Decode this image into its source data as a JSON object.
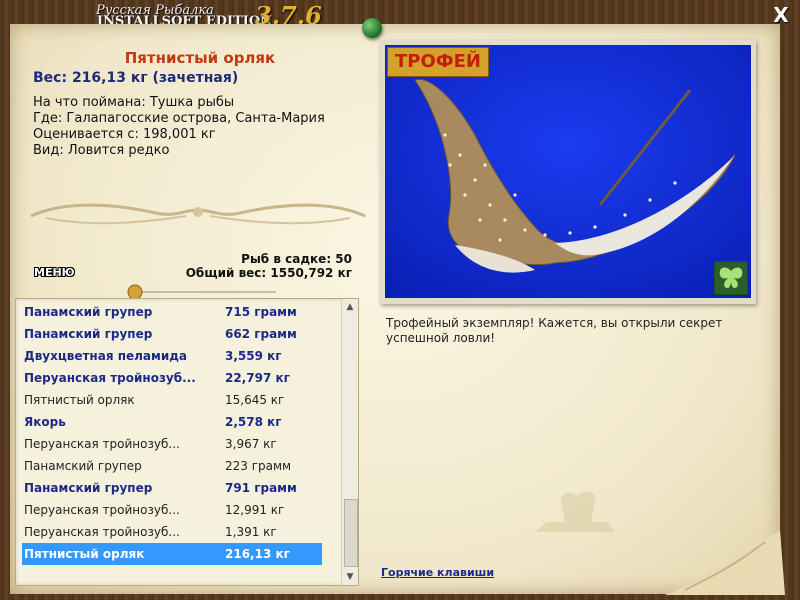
{
  "window": {
    "title_line1": "Русская Рыбалка",
    "title_line2": "INSTALLSOFT EDITION",
    "version": "3.7.6",
    "close_label": "X"
  },
  "catch": {
    "name": "Пятнистый орляк",
    "weight": "Вес: 216,13 кг (зачетная)",
    "bait": "На что поймана: Тушка рыбы",
    "place": "Где: Галапагосские острова, Санта-Мария",
    "value": "Оценивается с: 198,001 кг",
    "kind": "Вид: Ловится редко"
  },
  "stats": {
    "fish_count": "Рыб в садке: 50",
    "total_weight": "Общий вес: 1550,792 кг"
  },
  "menu_label": "МЕНЮ",
  "trophy": {
    "badge": "ТРОФЕЙ",
    "text": "Трофейный экземпляр! Кажется, вы открыли секрет успешной ловли!"
  },
  "hotkeys_label": "Горячие клавиши",
  "catches": [
    {
      "name": "Панамский групер",
      "weight": "715 грамм",
      "style": "bold"
    },
    {
      "name": "Панамский групер",
      "weight": "662 грамм",
      "style": "bold"
    },
    {
      "name": "Двухцветная пеламида",
      "weight": "3,559 кг",
      "style": "bold"
    },
    {
      "name": "Перуанская тройнозуб...",
      "weight": "22,797 кг",
      "style": "bold"
    },
    {
      "name": "Пятнистый орляк",
      "weight": "15,645 кг",
      "style": "plain"
    },
    {
      "name": "Якорь",
      "weight": "2,578 кг",
      "style": "bold"
    },
    {
      "name": "Перуанская тройнозуб...",
      "weight": "3,967 кг",
      "style": "plain"
    },
    {
      "name": "Панамский групер",
      "weight": "223 грамм",
      "style": "plain"
    },
    {
      "name": "Панамский групер",
      "weight": "791 грамм",
      "style": "bold"
    },
    {
      "name": "Перуанская тройнозуб...",
      "weight": "12,991 кг",
      "style": "plain"
    },
    {
      "name": "Перуанская тройнозуб...",
      "weight": "1,391 кг",
      "style": "plain"
    },
    {
      "name": "Пятнистый орляк",
      "weight": "216,13 кг",
      "style": "sel"
    }
  ],
  "colors": {
    "accent_title": "#c23a10",
    "accent_blue": "#1c2a78",
    "selection": "#3399ff",
    "photo_bg": "#1029d8"
  },
  "icons": {
    "close": "close-icon",
    "butterfly": "butterfly-icon",
    "pin": "pushpin-icon"
  }
}
